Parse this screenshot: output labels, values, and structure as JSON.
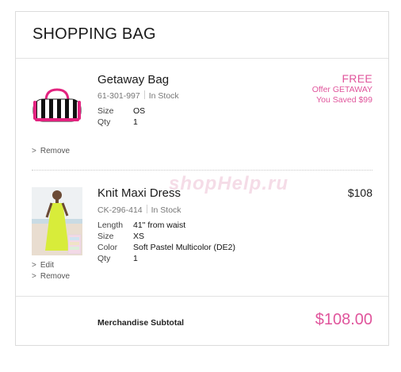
{
  "bag": {
    "title": "SHOPPING BAG"
  },
  "items": [
    {
      "name": "Getaway Bag",
      "sku": "61-301-997",
      "stock": "In Stock",
      "specs": [
        {
          "label": "Size",
          "value": "OS"
        },
        {
          "label": "Qty",
          "value": "1"
        }
      ],
      "price": "FREE",
      "offer": "Offer GETAWAY",
      "saved": "You Saved $99",
      "remove_label": "Remove",
      "image_icon": "striped-duffel-bag-thumbnail"
    },
    {
      "name": "Knit Maxi Dress",
      "sku": "CK-296-414",
      "stock": "In Stock",
      "specs": [
        {
          "label": "Length",
          "value": "41\" from waist"
        },
        {
          "label": "Size",
          "value": "XS"
        },
        {
          "label": "Color",
          "value": "Soft Pastel Multicolor (DE2)"
        },
        {
          "label": "Qty",
          "value": "1"
        }
      ],
      "price": "$108",
      "edit_label": "Edit",
      "remove_label": "Remove",
      "image_icon": "maxi-dress-model-thumbnail"
    }
  ],
  "subtotal": {
    "label": "Merchandise Subtotal",
    "value": "$108.00"
  },
  "watermark": "shopHelp.ru",
  "colors": {
    "accent": "#e0559c",
    "border": "#dcdcdc"
  }
}
